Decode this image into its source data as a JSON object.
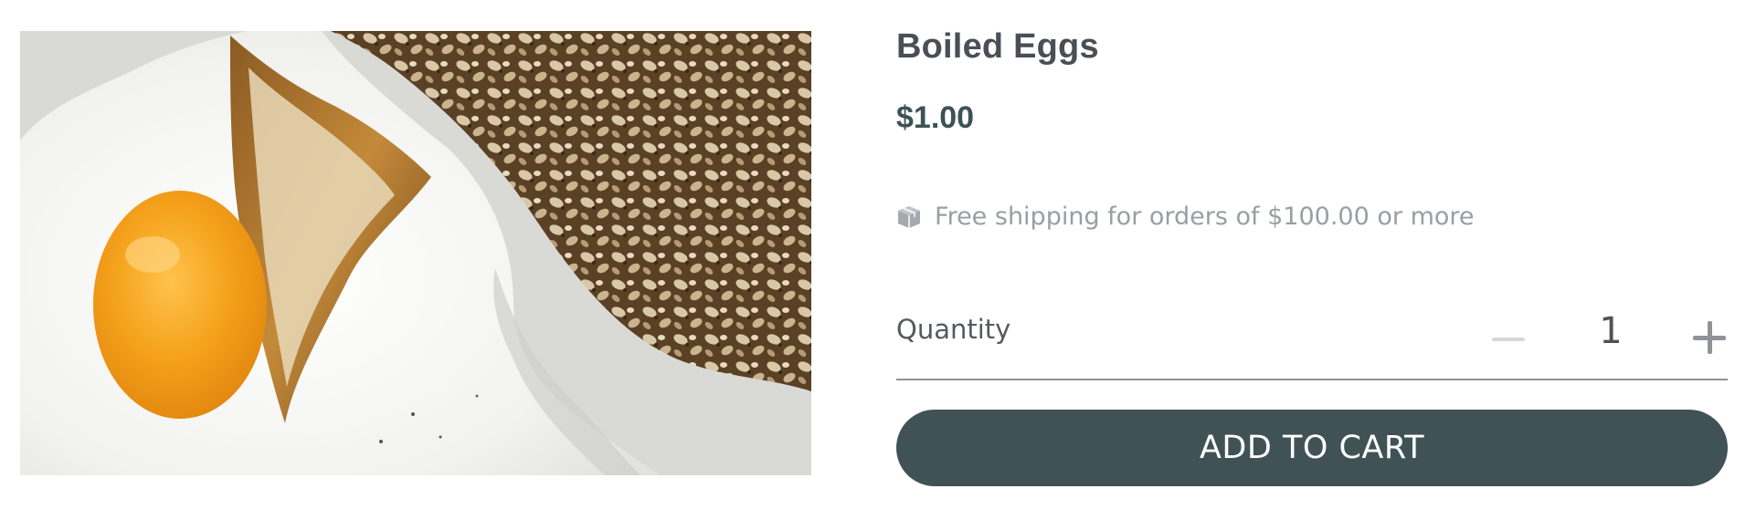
{
  "product": {
    "title": "Boiled Eggs",
    "price": "$1.00",
    "image_icon": "fried-egg-toast-photo"
  },
  "shipping": {
    "icon": "package-icon",
    "text": "Free shipping for orders of $100.00 or more"
  },
  "quantity": {
    "label": "Quantity",
    "value": "1",
    "minus_icon": "minus-icon",
    "plus_icon": "plus-icon"
  },
  "cart": {
    "button_label": "ADD TO CART"
  },
  "colors": {
    "accent": "#415256",
    "title": "#4a4f55",
    "muted": "#9a9ea3"
  }
}
